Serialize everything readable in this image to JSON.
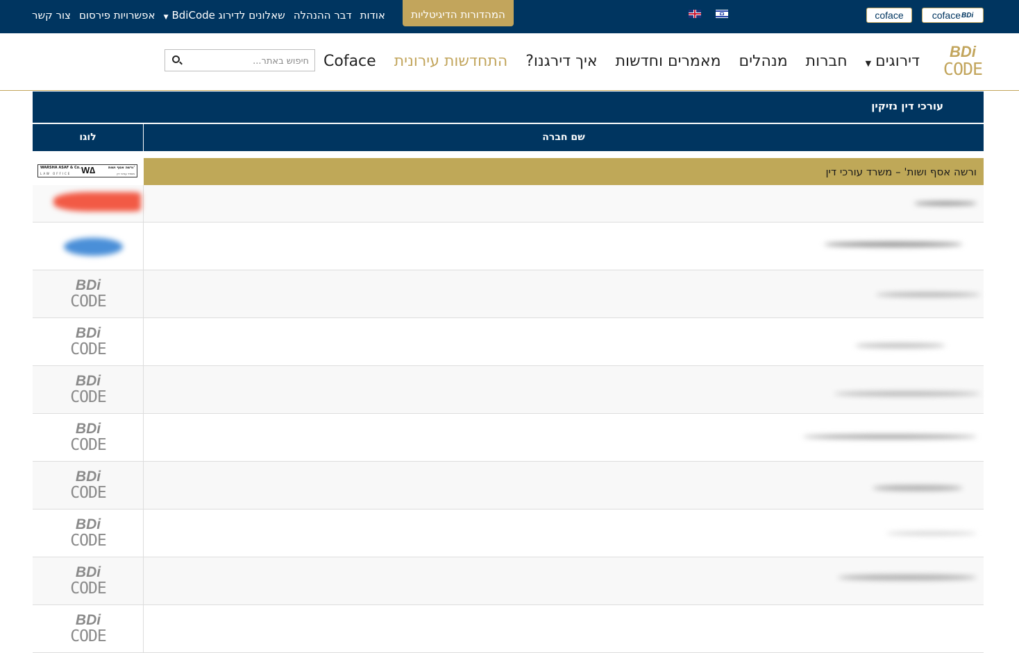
{
  "topbar": {
    "links": [
      {
        "label": "אודות"
      },
      {
        "label": "דבר ההנהלה"
      },
      {
        "label": "שאלונים לדירוג BdiCode",
        "dropdown": true
      },
      {
        "label": "אפשרויות פירסום"
      },
      {
        "label": "צור קשר"
      }
    ],
    "digital_label": "המהדורות הדיגיטליות",
    "coface_label": "coface",
    "coface_bdi_label": "coface",
    "coface_bdi_suffix": "BDi"
  },
  "logo": {
    "line1": "BDi",
    "line2": "CODE"
  },
  "nav": {
    "items": [
      {
        "label": "דירוגים",
        "dropdown": true
      },
      {
        "label": "חברות"
      },
      {
        "label": "מנהלים"
      },
      {
        "label": "מאמרים וחדשות"
      },
      {
        "label": "איך דירגנו?"
      },
      {
        "label": "התחדשות עירונית",
        "highlight": true
      },
      {
        "label": "Coface"
      }
    ]
  },
  "search": {
    "placeholder": "חיפוש באתר..."
  },
  "table": {
    "category_title": "עורכי דין נזיקין",
    "col_logo": "לוגו",
    "col_name": "שם חברה",
    "featured_row": {
      "name": "ורשה אסף ושות' – משרד עורכי דין",
      "logo": {
        "en_name": "WARSHA ASAF & Co.",
        "en_sub": "LAW OFFICE",
        "mark": "W∆",
        "he_name": "ורשה אסף ושות'",
        "he_sub": "משרד עורכי דין"
      }
    },
    "placeholder_logo": {
      "line1": "BDi",
      "line2": "CODE"
    }
  },
  "colors": {
    "navy": "#003560",
    "gold": "#c2a55c",
    "gold_row": "#bfa858"
  }
}
